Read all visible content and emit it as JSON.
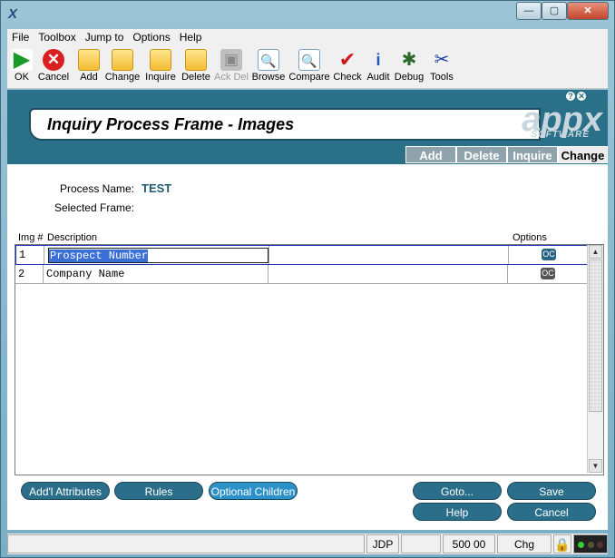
{
  "window": {
    "app_icon": "X",
    "controls": [
      "—",
      "▢",
      "✕"
    ]
  },
  "menu": [
    "File",
    "Toolbox",
    "Jump to",
    "Options",
    "Help"
  ],
  "toolbar": [
    {
      "label": "OK",
      "icon": "ok-icon",
      "glyph": "▶",
      "disabled": false
    },
    {
      "label": "Cancel",
      "icon": "cancel-icon",
      "glyph": "✕",
      "disabled": false
    },
    {
      "label": "Add",
      "icon": "add-folder-icon",
      "glyph": "",
      "disabled": false
    },
    {
      "label": "Change",
      "icon": "change-folder-icon",
      "glyph": "",
      "disabled": false
    },
    {
      "label": "Inquire",
      "icon": "inquire-folder-icon",
      "glyph": "",
      "disabled": false
    },
    {
      "label": "Delete",
      "icon": "delete-folder-icon",
      "glyph": "",
      "disabled": false
    },
    {
      "label": "Ack Del",
      "icon": "ack-delete-icon",
      "glyph": "▣",
      "disabled": true
    },
    {
      "label": "Browse",
      "icon": "browse-icon",
      "glyph": "🔍",
      "disabled": false
    },
    {
      "label": "Compare",
      "icon": "compare-icon",
      "glyph": "🔍",
      "disabled": false
    },
    {
      "label": "Check",
      "icon": "check-icon",
      "glyph": "✔",
      "disabled": false
    },
    {
      "label": "Audit",
      "icon": "audit-icon",
      "glyph": "i",
      "disabled": false
    },
    {
      "label": "Debug",
      "icon": "debug-icon",
      "glyph": "✱",
      "disabled": false
    },
    {
      "label": "Tools",
      "icon": "tools-icon",
      "glyph": "✂",
      "disabled": false
    }
  ],
  "frame": {
    "title": "Inquiry Process Frame - Images",
    "logo": "appx",
    "logo_sub": "SOFTWARE",
    "help_glyph": "?",
    "close_glyph": "✕"
  },
  "mode_tabs": [
    {
      "label": "Add",
      "active": false
    },
    {
      "label": "Delete",
      "active": false
    },
    {
      "label": "Inquire",
      "active": false
    },
    {
      "label": "Change",
      "active": true
    }
  ],
  "fields": {
    "process_name_label": "Process Name:",
    "process_name_value": "TEST",
    "selected_frame_label": "Selected Frame:",
    "selected_frame_value": ""
  },
  "grid": {
    "columns": [
      "Img #",
      "Description",
      "Options"
    ],
    "rows": [
      {
        "num": "1",
        "description": "Prospect Number",
        "option_glyph": "OC",
        "selected": true
      },
      {
        "num": "2",
        "description": "Company Name",
        "option_glyph": "OC",
        "selected": false
      }
    ],
    "scroll_up": "▲",
    "scroll_down": "▼"
  },
  "buttons": {
    "add_attributes": "Add'l Attributes",
    "rules": "Rules",
    "optional_children": "Optional Children",
    "goto": "Goto...",
    "save": "Save",
    "help": "Help",
    "cancel": "Cancel"
  },
  "status": {
    "user": "JDP",
    "field1": "500 00",
    "mode": "Chg"
  },
  "colors": {
    "frame_teal": "#2b7089",
    "pill": "#2b6e8a",
    "pill_active": "#2c91c9"
  }
}
